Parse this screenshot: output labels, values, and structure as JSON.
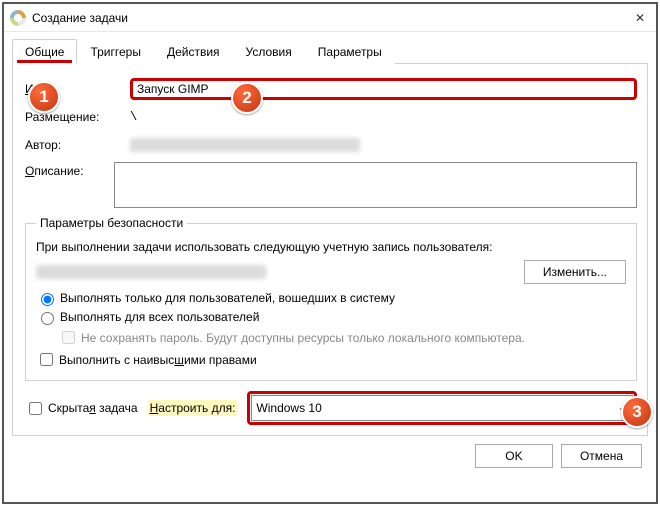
{
  "window": {
    "title": "Создание задачи"
  },
  "tabs": {
    "general": "Общие",
    "triggers": "Триггеры",
    "actions": "Действия",
    "conditions": "Условия",
    "settings": "Параметры"
  },
  "form": {
    "name_label": "Имя:",
    "name_value": "Запуск GIMP",
    "placement_label": "Размещение:",
    "placement_value": "\\",
    "author_label": "Автор:",
    "desc_label": "Описание:"
  },
  "security": {
    "legend": "Параметры безопасности",
    "msg": "При выполнении задачи использовать следующую учетную запись пользователя:",
    "change_btn": "Изменить...",
    "radio1": "Выполнять только для пользователей, вошедших в систему",
    "radio2": "Выполнять для всех пользователей",
    "nosave": "Не сохранять пароль. Будут доступны ресурсы только локального компьютера.",
    "elevated": "Выполнить с наивысшими правами"
  },
  "bottom": {
    "hidden": "Скрытая задача",
    "configure_for": "Настроить для:",
    "os": "Windows 10"
  },
  "buttons": {
    "ok": "OK",
    "cancel": "Отмена"
  },
  "badges": {
    "b1": "1",
    "b2": "2",
    "b3": "3"
  }
}
